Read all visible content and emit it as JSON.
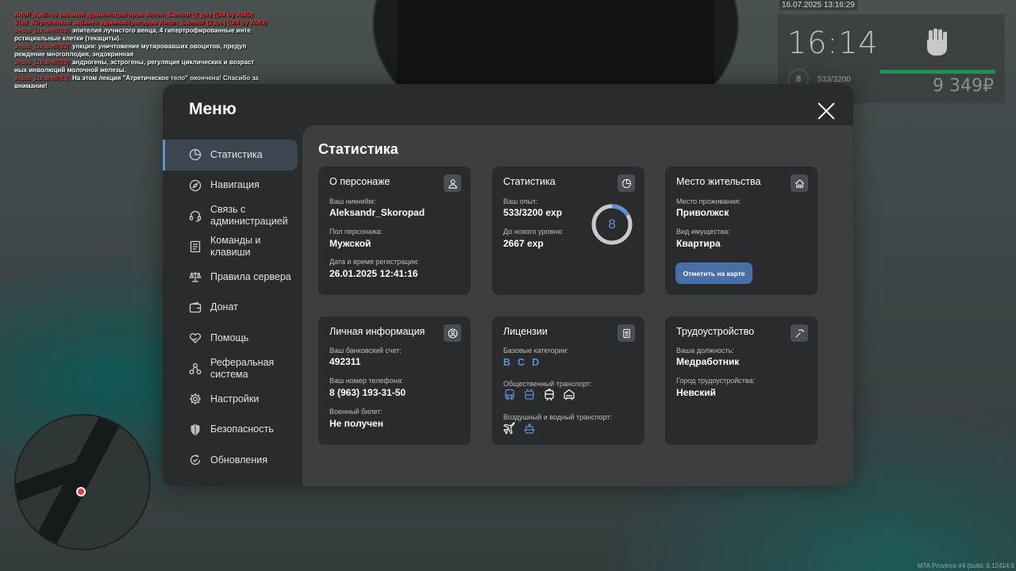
{
  "chat": {
    "lines": [
      {
        "text": "Adolf_Kadirov забанен администратором Anton_Sambur (2 дн.) (DM by AMD)",
        "kind": "red"
      },
      {
        "text": "Vlad_Kirpichenkov забанен администратором Anton_Sambur (2 дн.) (DM by AMD)",
        "kind": "red"
      },
      {
        "nick": "Jesus_Lucarelli[83]:",
        "text": "эпителия лучистого венца, 4 гипертрофированные инте"
      },
      {
        "text": "рстициальные клетки (текациты)."
      },
      {
        "nick": "Jesus_Lucarelli[83]:",
        "text": "ункции: уничтожение мутировавших овоцитов, предуп"
      },
      {
        "text": "реждение многоплодия, эндокринная"
      },
      {
        "nick": "Jesus_Lucarelli[83]:",
        "text": "андрогены, эстрогены, регуляция циклических и возраст"
      },
      {
        "text": "ных инволюций молочной железы."
      },
      {
        "nick": "Jesus_Lucarelli[83]:",
        "text": "На этом лекция \"Атретическое тело\" окончена! Спасибо за"
      },
      {
        "text": "внимание!"
      }
    ]
  },
  "hud": {
    "datetime": "16.07.2025 13:16:29",
    "time": "16:14",
    "level": "8",
    "exp": "533/3200",
    "money": "9 349₽"
  },
  "build": "MTA Province #4 (build: 6.12414.9",
  "menu": {
    "title": "Меню",
    "nav": [
      {
        "label": "Статистика",
        "icon": "pie-chart-icon",
        "active": true
      },
      {
        "label": "Навигация",
        "icon": "compass-icon"
      },
      {
        "label": "Связь с администрацией",
        "icon": "headset-icon"
      },
      {
        "label": "Команды и клавиши",
        "icon": "document-icon"
      },
      {
        "label": "Правила сервера",
        "icon": "scales-icon"
      },
      {
        "label": "Донат",
        "icon": "wallet-icon"
      },
      {
        "label": "Помощь",
        "icon": "heart-hand-icon"
      },
      {
        "label": "Реферальная система",
        "icon": "network-icon"
      },
      {
        "label": "Настройки",
        "icon": "gear-icon"
      },
      {
        "label": "Безопасность",
        "icon": "shield-icon"
      },
      {
        "label": "Обновления",
        "icon": "refresh-check-icon"
      }
    ]
  },
  "content": {
    "title": "Статистика",
    "character": {
      "title": "О персонаже",
      "nick_label": "Ваш никнейм:",
      "nick": "Aleksandr_Skoropad",
      "gender_label": "Пол персонажа:",
      "gender": "Мужской",
      "reg_label": "Дата и время регистрации:",
      "reg": "26.01.2025 12:41:16"
    },
    "stats": {
      "title": "Статистика",
      "exp_label": "Ваш опыт:",
      "exp": "533/3200 exp",
      "next_label": "До нового уровня:",
      "next": "2667 exp",
      "level": "8",
      "progress": 0.1666
    },
    "residence": {
      "title": "Место жительства",
      "place_label": "Место проживания:",
      "place": "Приволжск",
      "property_label": "Вид имущества:",
      "property": "Квартира",
      "map_button": "Отметить на карте"
    },
    "personal": {
      "title": "Личная информация",
      "bank_label": "Ваш банковский счет:",
      "bank": "492311",
      "phone_label": "Ваш номер телефона:",
      "phone": "8 (963) 193-31-50",
      "military_label": "Военный билет:",
      "military": "Не получен"
    },
    "licenses": {
      "title": "Лицензии",
      "base_label": "Базовые категории:",
      "categories": [
        "B",
        "C",
        "D"
      ],
      "public_label": "Общественный транспорт:",
      "public_icons": [
        "bus-icon",
        "trolleybus-icon",
        "tram-icon",
        "metro-icon"
      ],
      "air_label": "Воздушный и водный транспорт:",
      "air_icons": [
        "airplane-icon",
        "boat-icon"
      ]
    },
    "employment": {
      "title": "Трудоустройство",
      "position_label": "Ваша должность:",
      "position": "Медработник",
      "city_label": "Город трудоустройства:",
      "city": "Невский"
    }
  },
  "colors": {
    "accent": "#5f8fd6",
    "button": "#4a6fa8",
    "panel": "#2a2b2c",
    "content": "#3d3e3f"
  }
}
